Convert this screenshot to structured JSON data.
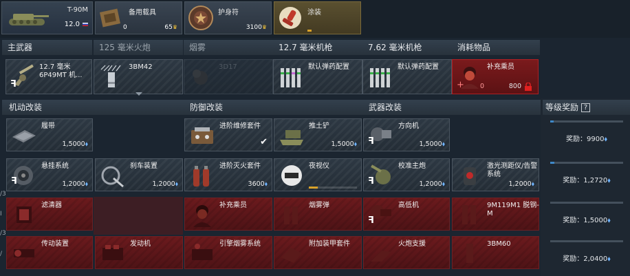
{
  "top": {
    "vehicle_name": "T-90M",
    "vehicle_br": "12.0",
    "backup_title": "备用载具",
    "backup_count": "0",
    "backup_price": "65",
    "talisman_title": "护身符",
    "talisman_price": "3100",
    "decal_title": "涂装"
  },
  "weapons": {
    "main_header": "主武器",
    "main_label_line1": "12.7 毫米",
    "main_label_line2": "6P49MT 机...",
    "cannon_header": "125 毫米火炮",
    "cannon_label": "3BM42",
    "smoke_header": "烟雾",
    "smoke_label": "3D17",
    "hmg_header": "12.7 毫米机枪",
    "hmg_label": "默认弹药配置",
    "mg_header": "7.62 毫米机枪",
    "mg_label": "默认弹药配置",
    "consumable_header": "消耗物品",
    "consumable_label": "补充乘员",
    "consumable_count": "0",
    "consumable_price": "800"
  },
  "sections": {
    "mobility": "机动改装",
    "protection": "防御改装",
    "firepower": "武器改装",
    "rank_reward": "等级奖励",
    "rank_help": "?"
  },
  "mods": {
    "tracks": {
      "label": "履带",
      "cost": "1,5000"
    },
    "suspension": {
      "label": "悬挂系统",
      "cost": "1,2000"
    },
    "brakes": {
      "label": "刹车装置",
      "cost": "1,2000"
    },
    "filters": {
      "label": "滤清器"
    },
    "transmission": {
      "label": "传动装置"
    },
    "engine": {
      "label": "发动机"
    },
    "repair_kit": {
      "label": "进阶维修套件"
    },
    "fire_ext": {
      "label": "进阶灭火套件",
      "cost": "3600"
    },
    "crew_repl": {
      "label": "补充乘员"
    },
    "smoke_grenade": {
      "label": "引擎烟雾系统"
    },
    "dozer": {
      "label": "推土铲",
      "cost": "1,5000"
    },
    "night_vision": {
      "label": "夜视仪"
    },
    "smoke_shell": {
      "label": "烟雾弹"
    },
    "add_armor": {
      "label": "附加装甲套件"
    },
    "traverse": {
      "label": "方向机",
      "cost": "1,5000"
    },
    "adjust": {
      "label": "校准主炮",
      "cost": "1,2000"
    },
    "elevation": {
      "label": "高低机"
    },
    "artillery": {
      "label": "火炮支援"
    },
    "laser": {
      "label": "激光测距仪/告警系统",
      "cost": "1,2000"
    },
    "atgm": {
      "label": "9M119M1 脱钢-M"
    },
    "apfsds": {
      "label": "3BM60"
    }
  },
  "rewards": [
    {
      "label": "奖励：",
      "value": "9900",
      "progress": 0.05
    },
    {
      "label": "奖励：",
      "value": "1,2720",
      "progress": 0.06
    },
    {
      "label": "奖励：",
      "value": "1,5000",
      "progress": 0.0
    },
    {
      "label": "奖励：",
      "value": "2,0400",
      "progress": 0.0
    }
  ],
  "side_marks": [
    "/3",
    "I",
    "/3",
    "/"
  ],
  "colors": {
    "background": "#1b2530",
    "locked_red": "#6b1a1d",
    "rp_blue": "#6fb3ff",
    "gold": "#f2c23a"
  }
}
